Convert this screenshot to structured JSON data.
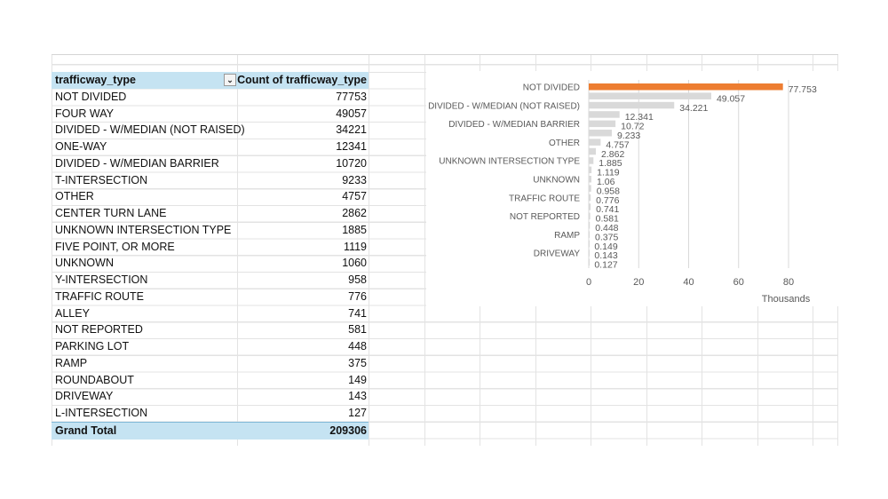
{
  "pivot": {
    "header": {
      "row_label": "trafficway_type",
      "value_label": "Count of trafficway_type"
    },
    "rows": [
      {
        "label": "NOT DIVIDED",
        "count": "77753"
      },
      {
        "label": "FOUR WAY",
        "count": "49057"
      },
      {
        "label": "DIVIDED - W/MEDIAN (NOT RAISED)",
        "count": "34221"
      },
      {
        "label": "ONE-WAY",
        "count": "12341"
      },
      {
        "label": "DIVIDED - W/MEDIAN BARRIER",
        "count": "10720"
      },
      {
        "label": "T-INTERSECTION",
        "count": "9233"
      },
      {
        "label": "OTHER",
        "count": "4757"
      },
      {
        "label": "CENTER TURN LANE",
        "count": "2862"
      },
      {
        "label": "UNKNOWN INTERSECTION TYPE",
        "count": "1885"
      },
      {
        "label": "FIVE POINT, OR MORE",
        "count": "1119"
      },
      {
        "label": "UNKNOWN",
        "count": "1060"
      },
      {
        "label": "Y-INTERSECTION",
        "count": "958"
      },
      {
        "label": "TRAFFIC ROUTE",
        "count": "776"
      },
      {
        "label": "ALLEY",
        "count": "741"
      },
      {
        "label": "NOT REPORTED",
        "count": "581"
      },
      {
        "label": "PARKING LOT",
        "count": "448"
      },
      {
        "label": "RAMP",
        "count": "375"
      },
      {
        "label": "ROUNDABOUT",
        "count": "149"
      },
      {
        "label": "DRIVEWAY",
        "count": "143"
      },
      {
        "label": "L-INTERSECTION",
        "count": "127"
      }
    ],
    "total": {
      "label": "Grand Total",
      "count": "209306"
    }
  },
  "chart_data": {
    "type": "bar",
    "orientation": "horizontal",
    "categories": [
      "NOT DIVIDED",
      "FOUR WAY",
      "DIVIDED - W/MEDIAN (NOT RAISED)",
      "ONE-WAY",
      "DIVIDED - W/MEDIAN BARRIER",
      "T-INTERSECTION",
      "OTHER",
      "CENTER TURN LANE",
      "UNKNOWN INTERSECTION TYPE",
      "FIVE POINT, OR MORE",
      "UNKNOWN",
      "Y-INTERSECTION",
      "TRAFFIC ROUTE",
      "ALLEY",
      "NOT REPORTED",
      "PARKING LOT",
      "RAMP",
      "ROUNDABOUT",
      "DRIVEWAY",
      "L-INTERSECTION"
    ],
    "shown_category_labels": [
      "NOT DIVIDED",
      "DIVIDED - W/MEDIAN (NOT RAISED)",
      "DIVIDED - W/MEDIAN BARRIER",
      "OTHER",
      "UNKNOWN INTERSECTION TYPE",
      "UNKNOWN",
      "TRAFFIC ROUTE",
      "NOT REPORTED",
      "RAMP",
      "DRIVEWAY"
    ],
    "values": [
      77.753,
      49.057,
      34.221,
      12.341,
      10.72,
      9.233,
      4.757,
      2.862,
      1.885,
      1.119,
      1.06,
      0.958,
      0.776,
      0.741,
      0.581,
      0.448,
      0.375,
      0.149,
      0.143,
      0.127
    ],
    "data_labels": [
      "77.753",
      "49.057",
      "34.221",
      "12.341",
      "10.72",
      "9.233",
      "4.757",
      "2.862",
      "1.885",
      "1.119",
      "1.06",
      "0.958",
      "0.776",
      "0.741",
      "0.581",
      "0.448",
      "0.375",
      "0.149",
      "0.143",
      "0.127"
    ],
    "xticks": [
      "0",
      "20",
      "40",
      "60",
      "80"
    ],
    "xlim": [
      0,
      80
    ],
    "xlabel": "Thousands",
    "grid": true,
    "colors": {
      "highlight": "#ed7d31",
      "bar": "#d9d9d9",
      "grid": "#d9d9d9",
      "text": "#595959"
    }
  }
}
